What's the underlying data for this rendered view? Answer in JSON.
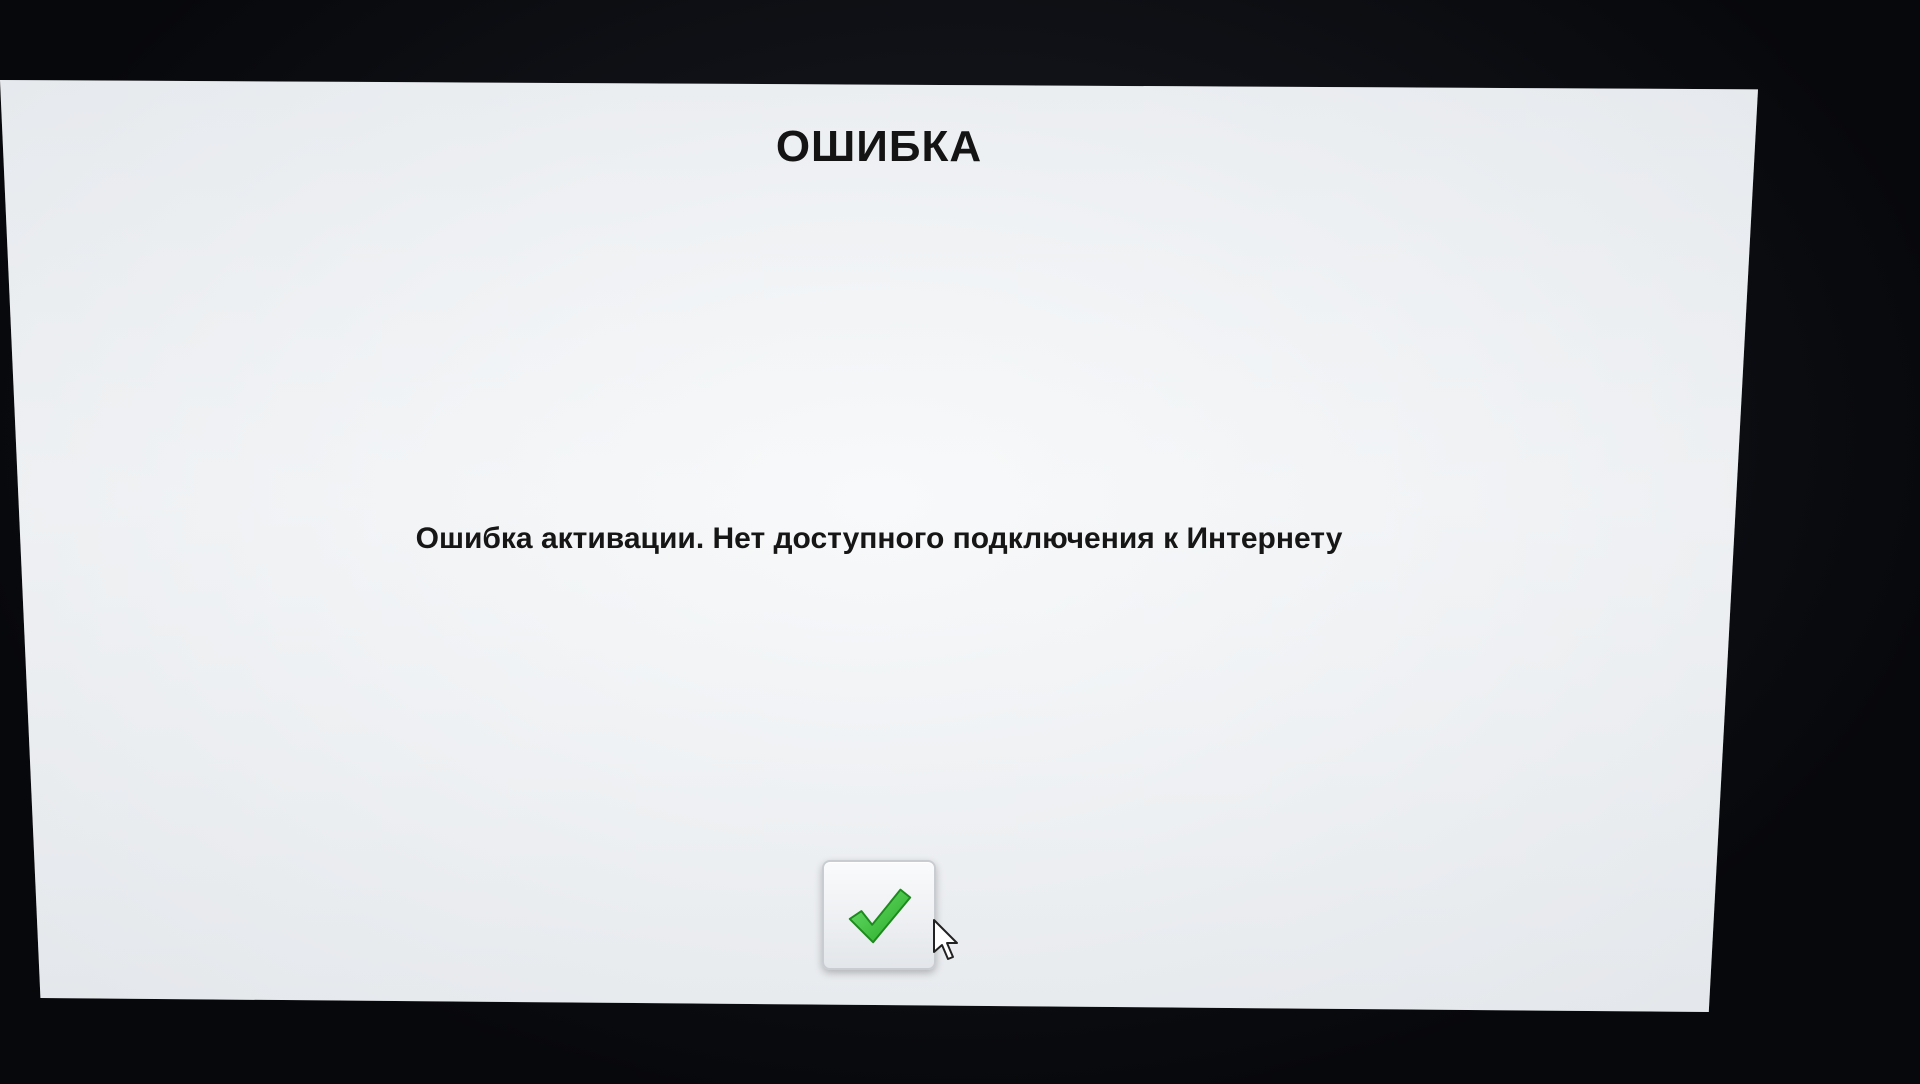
{
  "dialog": {
    "title": "ОШИБКА",
    "message": "Ошибка активации. Нет доступного подключения к Интернету",
    "confirm_icon": "checkmark-icon"
  },
  "pointer": {
    "icon": "cursor-arrow-icon"
  },
  "colors": {
    "screen_background": "#f0f3f5",
    "text": "#141414",
    "checkmark": "#3cc23c",
    "bezel": "#0b0d12"
  }
}
